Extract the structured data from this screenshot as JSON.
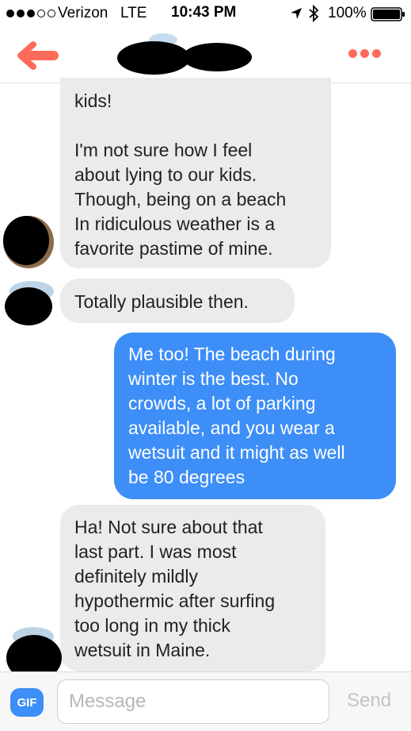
{
  "status_bar": {
    "signal_bars_filled": 3,
    "signal_bars_total": 5,
    "carrier": "Verizon",
    "network": "LTE",
    "time": "10:43 PM",
    "battery": "100%"
  },
  "header": {
    "back_icon": "back-arrow-icon",
    "more_icon": "more-dots-icon",
    "accent_color": "#ff6b5a"
  },
  "messages": [
    {
      "direction": "incoming",
      "lines": [
        "kids!",
        "",
        "I'm not sure how I feel",
        "about lying to our kids.",
        "Though, being on a beach",
        "In ridiculous weather is a",
        "favorite pastime of mine."
      ]
    },
    {
      "direction": "incoming",
      "lines": [
        "Totally plausible then."
      ]
    },
    {
      "direction": "outgoing",
      "lines": [
        "Me too! The beach during",
        "winter is the best. No",
        "crowds, a lot of parking",
        "available, and you wear a",
        "wetsuit and it might as well",
        "be 80 degrees"
      ]
    },
    {
      "direction": "incoming",
      "lines": [
        "Ha! Not sure about that",
        "last part. I was most",
        "definitely mildly",
        "hypothermic after surfing",
        "too long in my thick",
        "wetsuit in Maine."
      ]
    }
  ],
  "input_bar": {
    "gif_label": "GIF",
    "placeholder": "Message",
    "send_label": "Send"
  },
  "colors": {
    "outgoing_bubble": "#3d8ef7",
    "incoming_bubble": "#ebebeb"
  }
}
